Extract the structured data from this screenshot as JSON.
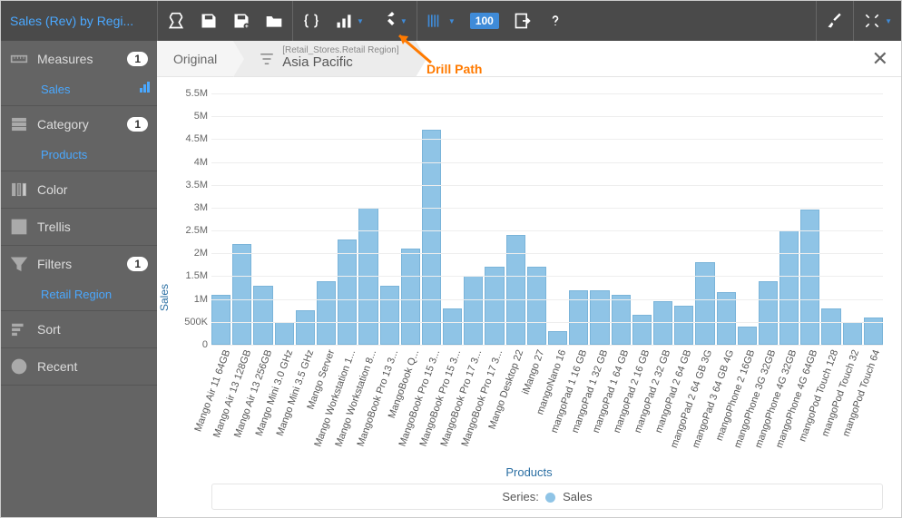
{
  "app_title": "Sales (Rev) by Regi...",
  "toolbar": {
    "sampling": "100"
  },
  "sidebar": {
    "measures": {
      "label": "Measures",
      "count": "1",
      "item": "Sales"
    },
    "category": {
      "label": "Category",
      "count": "1",
      "item": "Products"
    },
    "color": {
      "label": "Color"
    },
    "trellis": {
      "label": "Trellis"
    },
    "filters": {
      "label": "Filters",
      "count": "1",
      "item": "Retail Region"
    },
    "sort": {
      "label": "Sort"
    },
    "recent": {
      "label": "Recent"
    }
  },
  "breadcrumb": {
    "original": "Original",
    "drill_meta": "[Retail_Stores.Retail Region]",
    "drill_value": "Asia Pacific"
  },
  "annotation": "Drill Path",
  "legend": {
    "prefix": "Series:",
    "label": "Sales"
  },
  "chart_data": {
    "type": "bar",
    "title": "",
    "xlabel": "Products",
    "ylabel": "Sales",
    "ylim": [
      0,
      5500000
    ],
    "yticks": [
      "0",
      "500K",
      "1M",
      "1.5M",
      "2M",
      "2.5M",
      "3M",
      "3.5M",
      "4M",
      "4.5M",
      "5M",
      "5.5M"
    ],
    "categories": [
      "Mango Air 11 64GB",
      "Mango Air 13 128GB",
      "Mango Air 13 256GB",
      "Mango Mini 3.0 GHz",
      "Mango Mini 3.5 GHz",
      "Mango Server",
      "Mango Workstation 1...",
      "Mango Workstation 8...",
      "MangoBook Pro 13 3...",
      "MangoBook Q...",
      "MangoBook Pro 15 3...",
      "MangoBook Pro 15 3...",
      "MangoBook Pro 17 3...",
      "MangoBook Pro 17 3...",
      "Mango Desktop 22",
      "iMango 27",
      "mangoNano 16",
      "mangoPad 1 16 GB",
      "mangoPad 1 32 GB",
      "mangoPad 1 64 GB",
      "mangoPad 2 16 GB",
      "mangoPad 2 32 GB",
      "mangoPad 2 64 GB",
      "mangoPad 2 64 GB 3G",
      "mangoPad 3 64 GB 4G",
      "mangoPhone 2 16GB",
      "mangoPhone 3G 32GB",
      "mangoPhone 4G 32GB",
      "mangoPhone 4G 64GB",
      "mangoPod Touch 128",
      "mangoPod Touch 32",
      "mangoPod Touch 64"
    ],
    "values": [
      1100000,
      2200000,
      1300000,
      500000,
      750000,
      1400000,
      2300000,
      3000000,
      1300000,
      2100000,
      4700000,
      800000,
      1500000,
      1700000,
      2400000,
      1700000,
      300000,
      1200000,
      1200000,
      1100000,
      650000,
      950000,
      850000,
      1800000,
      1150000,
      400000,
      1400000,
      2500000,
      2950000,
      800000,
      500000,
      600000
    ]
  }
}
